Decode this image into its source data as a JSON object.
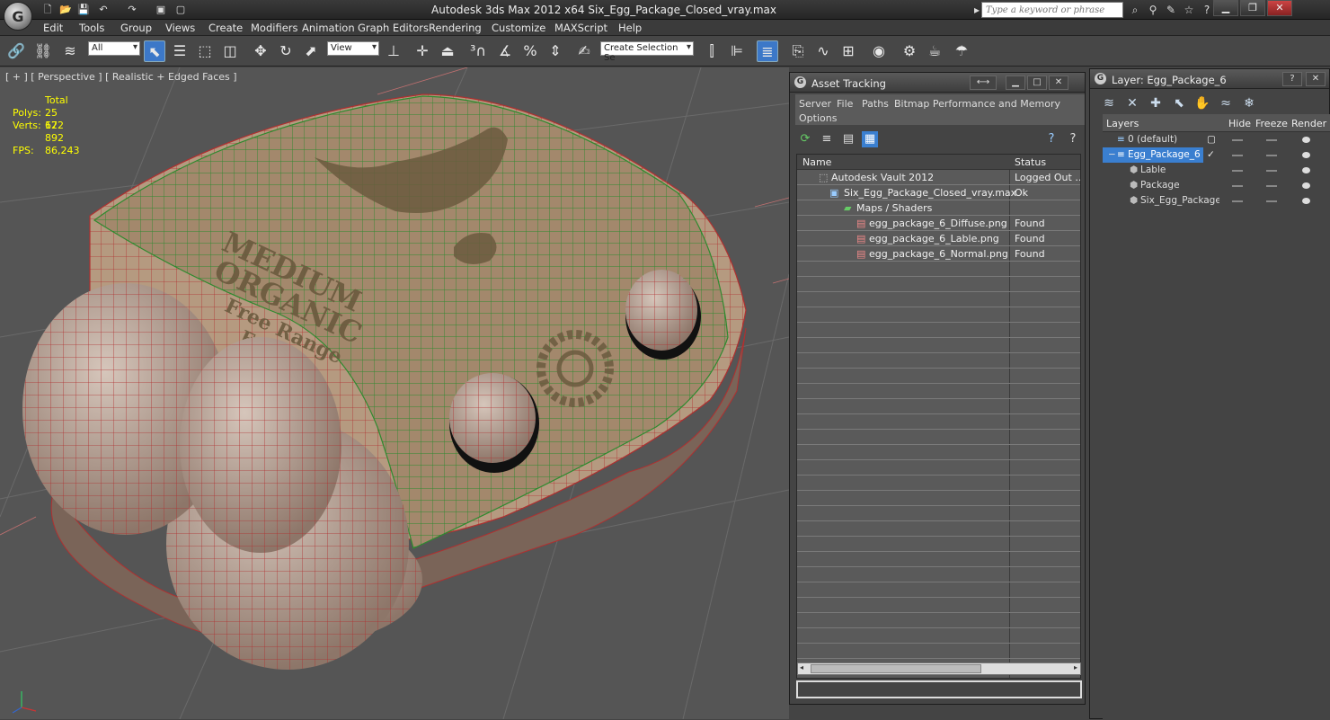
{
  "titlebar": {
    "title": "Autodesk 3ds Max  2012 x64      Six_Egg_Package_Closed_vray.max",
    "search_placeholder": "Type a keyword or phrase"
  },
  "menubar": [
    "Edit",
    "Tools",
    "Group",
    "Views",
    "Create",
    "Modifiers",
    "Animation",
    "Graph Editors",
    "Rendering",
    "Customize",
    "MAXScript",
    "Help"
  ],
  "toolbar": {
    "selection_filter": "All",
    "reference_coord": "View",
    "named_selection": "Create Selection Se"
  },
  "viewport": {
    "label": "[ + ] [ Perspective ] [ Realistic + Edged Faces ]",
    "stats_header": "Total",
    "stats": [
      {
        "label": "Polys:",
        "value": "25 672"
      },
      {
        "label": "Verts:",
        "value": "12 892"
      },
      {
        "label": "FPS:",
        "value": "86,243"
      }
    ],
    "label_texts": [
      "MEDIUM",
      "ORGANIC",
      "Free Range",
      "Eggs"
    ]
  },
  "asset_tracking": {
    "title": "Asset Tracking",
    "menu": [
      "Server",
      "File",
      "Paths",
      "Bitmap Performance and Memory",
      "Options"
    ],
    "columns": [
      "Name",
      "Status"
    ],
    "rows": [
      {
        "name": "Autodesk Vault 2012",
        "status": "Logged Out ..."
      },
      {
        "name": "Six_Egg_Package_Closed_vray.max",
        "status": "Ok"
      },
      {
        "name": "Maps / Shaders",
        "status": ""
      },
      {
        "name": "egg_package_6_Diffuse.png",
        "status": "Found"
      },
      {
        "name": "egg_package_6_Lable.png",
        "status": "Found"
      },
      {
        "name": "egg_package_6_Normal.png",
        "status": "Found"
      }
    ]
  },
  "layer": {
    "title": "Layer: Egg_Package_6",
    "columns": [
      "Layers",
      "Hide",
      "Freeze",
      "Render"
    ],
    "rows": [
      {
        "name": "0 (default)"
      },
      {
        "name": "Egg_Package_6"
      },
      {
        "name": "Lable"
      },
      {
        "name": "Package"
      },
      {
        "name": "Six_Egg_Package"
      }
    ]
  },
  "colors": {
    "wire": "#b03030",
    "label_wire": "#2f8a2f",
    "cardboard": "#b59a80",
    "selection": "#3a7fd0",
    "stats": "#ffff00"
  }
}
